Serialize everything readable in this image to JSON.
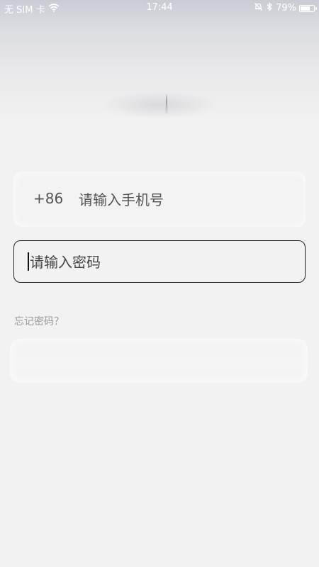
{
  "status_bar": {
    "carrier": "无 SIM 卡",
    "time": "17:44",
    "battery_percent": "79%",
    "battery_level": 0.79,
    "icons": [
      "wifi-icon",
      "alarm-off-icon",
      "bluetooth-icon",
      "battery-icon"
    ]
  },
  "login": {
    "country_code": "+86",
    "phone_placeholder": "请输入手机号",
    "password_placeholder": "请输入密码",
    "forgot_password": "忘记密码？"
  },
  "colors": {
    "background": "#f2f2f2",
    "field_border_active": "#222222",
    "muted_text": "#999999"
  }
}
